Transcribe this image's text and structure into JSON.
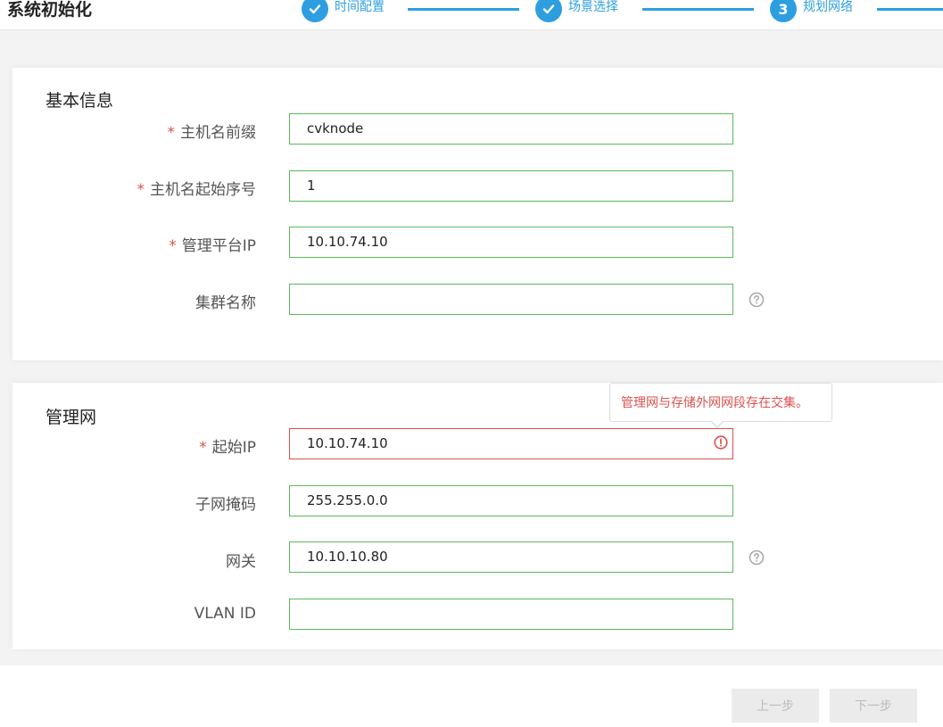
{
  "header": {
    "title": "系统初始化",
    "steps": [
      {
        "label": "时间配置",
        "state": "done"
      },
      {
        "label": "场景选择",
        "state": "done"
      },
      {
        "label": "规划网络",
        "number": "3",
        "state": "active"
      }
    ]
  },
  "basic_info": {
    "title": "基本信息",
    "fields": [
      {
        "label": "主机名前缀",
        "required": "*",
        "value": "cvknode"
      },
      {
        "label": "主机名起始序号",
        "required": "*",
        "value": "1"
      },
      {
        "label": "管理平台IP",
        "required": "*",
        "value": "10.10.74.10"
      },
      {
        "label": "集群名称",
        "value": "",
        "help_icon": "question-circle-icon"
      }
    ]
  },
  "mgmt_network": {
    "title": "管理网",
    "tooltip": "管理网与存储外网网段存在交集。",
    "fields": [
      {
        "label": "起始IP",
        "required": "*",
        "value": "10.10.74.10",
        "error_icon": "exclamation-circle-icon"
      },
      {
        "label": "子网掩码",
        "value": "255.255.0.0"
      },
      {
        "label": "网关",
        "value": "10.10.10.80",
        "help_icon": "question-circle-icon"
      },
      {
        "label": "VLAN ID",
        "value": ""
      }
    ]
  },
  "footer": {
    "prev_label": "上一步",
    "next_label": "下一步"
  },
  "colors": {
    "accent": "#2d9fe0",
    "valid_border": "#5cb85c",
    "error": "#d9534f"
  }
}
